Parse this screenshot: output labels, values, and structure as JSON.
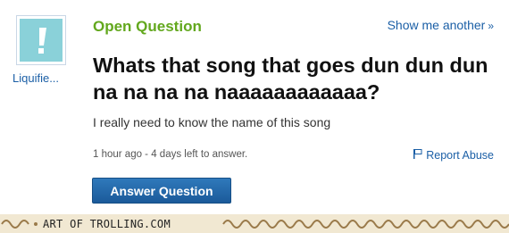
{
  "user": {
    "name": "Liquifie..."
  },
  "header": {
    "section_label": "Open Question",
    "show_another": "Show me another",
    "chevron": "»"
  },
  "question": {
    "title": "Whats that song that goes dun dun dun na na na na naaaaaaaaaaaa?",
    "details": "I really need to know the name of this song",
    "meta": "1 hour ago - 4 days left to answer."
  },
  "actions": {
    "report_abuse": "Report Abuse",
    "answer_button": "Answer Question"
  },
  "footer": {
    "watermark": "ART OF TROLLING.COM"
  },
  "colors": {
    "link": "#1b5fa6",
    "section_green": "#63a81e",
    "button": "#1f64a8",
    "footer_bg": "#f1e8d2"
  }
}
